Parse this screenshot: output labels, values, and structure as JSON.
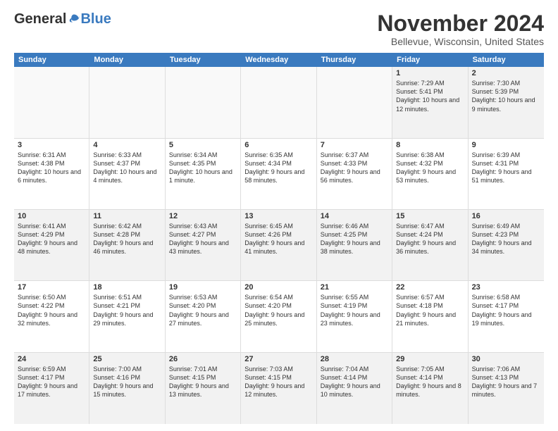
{
  "logo": {
    "general": "General",
    "blue": "Blue"
  },
  "title": "November 2024",
  "location": "Bellevue, Wisconsin, United States",
  "header_days": [
    "Sunday",
    "Monday",
    "Tuesday",
    "Wednesday",
    "Thursday",
    "Friday",
    "Saturday"
  ],
  "weeks": [
    [
      {
        "day": "",
        "info": "",
        "empty": true
      },
      {
        "day": "",
        "info": "",
        "empty": true
      },
      {
        "day": "",
        "info": "",
        "empty": true
      },
      {
        "day": "",
        "info": "",
        "empty": true
      },
      {
        "day": "",
        "info": "",
        "empty": true
      },
      {
        "day": "1",
        "info": "Sunrise: 7:29 AM\nSunset: 5:41 PM\nDaylight: 10 hours\nand 12 minutes."
      },
      {
        "day": "2",
        "info": "Sunrise: 7:30 AM\nSunset: 5:39 PM\nDaylight: 10 hours\nand 9 minutes."
      }
    ],
    [
      {
        "day": "3",
        "info": "Sunrise: 6:31 AM\nSunset: 4:38 PM\nDaylight: 10 hours\nand 6 minutes."
      },
      {
        "day": "4",
        "info": "Sunrise: 6:33 AM\nSunset: 4:37 PM\nDaylight: 10 hours\nand 4 minutes."
      },
      {
        "day": "5",
        "info": "Sunrise: 6:34 AM\nSunset: 4:35 PM\nDaylight: 10 hours\nand 1 minute."
      },
      {
        "day": "6",
        "info": "Sunrise: 6:35 AM\nSunset: 4:34 PM\nDaylight: 9 hours\nand 58 minutes."
      },
      {
        "day": "7",
        "info": "Sunrise: 6:37 AM\nSunset: 4:33 PM\nDaylight: 9 hours\nand 56 minutes."
      },
      {
        "day": "8",
        "info": "Sunrise: 6:38 AM\nSunset: 4:32 PM\nDaylight: 9 hours\nand 53 minutes."
      },
      {
        "day": "9",
        "info": "Sunrise: 6:39 AM\nSunset: 4:31 PM\nDaylight: 9 hours\nand 51 minutes."
      }
    ],
    [
      {
        "day": "10",
        "info": "Sunrise: 6:41 AM\nSunset: 4:29 PM\nDaylight: 9 hours\nand 48 minutes."
      },
      {
        "day": "11",
        "info": "Sunrise: 6:42 AM\nSunset: 4:28 PM\nDaylight: 9 hours\nand 46 minutes."
      },
      {
        "day": "12",
        "info": "Sunrise: 6:43 AM\nSunset: 4:27 PM\nDaylight: 9 hours\nand 43 minutes."
      },
      {
        "day": "13",
        "info": "Sunrise: 6:45 AM\nSunset: 4:26 PM\nDaylight: 9 hours\nand 41 minutes."
      },
      {
        "day": "14",
        "info": "Sunrise: 6:46 AM\nSunset: 4:25 PM\nDaylight: 9 hours\nand 38 minutes."
      },
      {
        "day": "15",
        "info": "Sunrise: 6:47 AM\nSunset: 4:24 PM\nDaylight: 9 hours\nand 36 minutes."
      },
      {
        "day": "16",
        "info": "Sunrise: 6:49 AM\nSunset: 4:23 PM\nDaylight: 9 hours\nand 34 minutes."
      }
    ],
    [
      {
        "day": "17",
        "info": "Sunrise: 6:50 AM\nSunset: 4:22 PM\nDaylight: 9 hours\nand 32 minutes."
      },
      {
        "day": "18",
        "info": "Sunrise: 6:51 AM\nSunset: 4:21 PM\nDaylight: 9 hours\nand 29 minutes."
      },
      {
        "day": "19",
        "info": "Sunrise: 6:53 AM\nSunset: 4:20 PM\nDaylight: 9 hours\nand 27 minutes."
      },
      {
        "day": "20",
        "info": "Sunrise: 6:54 AM\nSunset: 4:20 PM\nDaylight: 9 hours\nand 25 minutes."
      },
      {
        "day": "21",
        "info": "Sunrise: 6:55 AM\nSunset: 4:19 PM\nDaylight: 9 hours\nand 23 minutes."
      },
      {
        "day": "22",
        "info": "Sunrise: 6:57 AM\nSunset: 4:18 PM\nDaylight: 9 hours\nand 21 minutes."
      },
      {
        "day": "23",
        "info": "Sunrise: 6:58 AM\nSunset: 4:17 PM\nDaylight: 9 hours\nand 19 minutes."
      }
    ],
    [
      {
        "day": "24",
        "info": "Sunrise: 6:59 AM\nSunset: 4:17 PM\nDaylight: 9 hours\nand 17 minutes."
      },
      {
        "day": "25",
        "info": "Sunrise: 7:00 AM\nSunset: 4:16 PM\nDaylight: 9 hours\nand 15 minutes."
      },
      {
        "day": "26",
        "info": "Sunrise: 7:01 AM\nSunset: 4:15 PM\nDaylight: 9 hours\nand 13 minutes."
      },
      {
        "day": "27",
        "info": "Sunrise: 7:03 AM\nSunset: 4:15 PM\nDaylight: 9 hours\nand 12 minutes."
      },
      {
        "day": "28",
        "info": "Sunrise: 7:04 AM\nSunset: 4:14 PM\nDaylight: 9 hours\nand 10 minutes."
      },
      {
        "day": "29",
        "info": "Sunrise: 7:05 AM\nSunset: 4:14 PM\nDaylight: 9 hours\nand 8 minutes."
      },
      {
        "day": "30",
        "info": "Sunrise: 7:06 AM\nSunset: 4:13 PM\nDaylight: 9 hours\nand 7 minutes."
      }
    ]
  ]
}
